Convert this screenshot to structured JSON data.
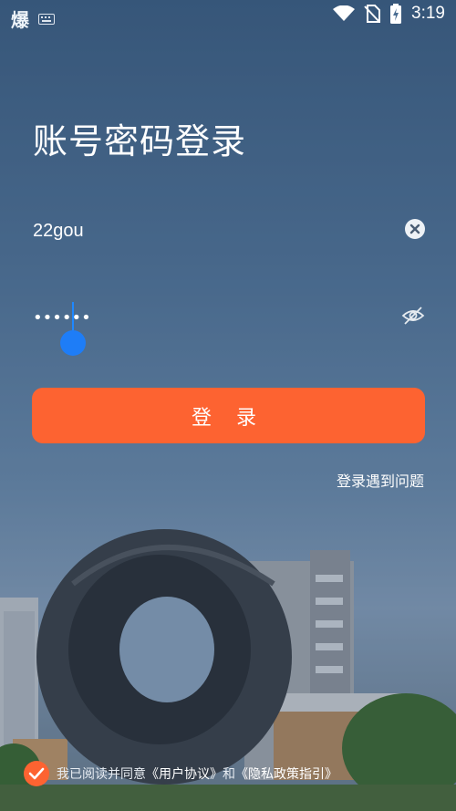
{
  "status_bar": {
    "app_glyph": "爆",
    "time": "3:19"
  },
  "title": "账号密码登录",
  "username": {
    "value": "22gou"
  },
  "password": {
    "mask": "••••••"
  },
  "login_button": "登 录",
  "help_link": "登录遇到问题",
  "agreement": {
    "prefix": "我已阅读并同意",
    "user_agreement": "《用户协议》",
    "conjunction": "和",
    "privacy_policy": "《隐私政策指引》",
    "checked": true
  },
  "colors": {
    "accent": "#fd6331",
    "cursor": "#1e7df7"
  }
}
